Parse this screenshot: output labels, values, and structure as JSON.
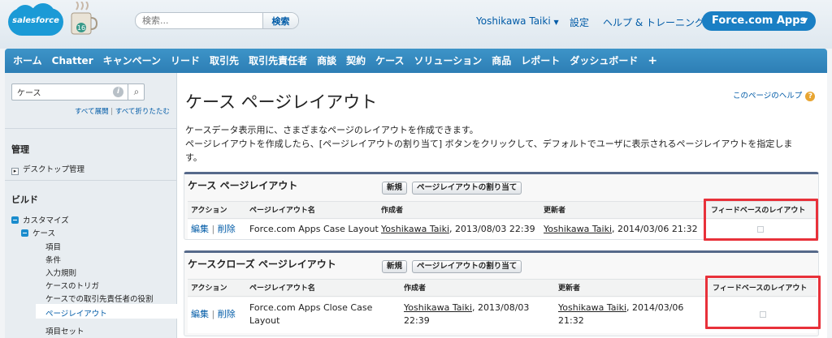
{
  "header": {
    "logo_text": "salesforce",
    "mug_badge": "16",
    "search_placeholder": "検索...",
    "search_button": "検索",
    "user_name": "Yoshikawa Taiki",
    "user_arrow": "▼",
    "setup": "設定",
    "help_training": "ヘルプ & トレーニング",
    "app_menu": "Force.com Apps",
    "app_arrow": "▼"
  },
  "tabs": [
    "ホーム",
    "Chatter",
    "キャンペーン",
    "リード",
    "取引先",
    "取引先責任者",
    "商談",
    "契約",
    "ケース",
    "ソリューション",
    "商品",
    "レポート",
    "ダッシュボード",
    "+"
  ],
  "sidebar": {
    "search_value": "ケース",
    "info_glyph": "i",
    "search_glyph": "⌕",
    "expand_all": "すべて展開",
    "separator": "|",
    "collapse_all": "すべて折りたたむ",
    "admin_heading": "管理",
    "desktop_admin": "デスクトップ管理",
    "build_heading": "ビルド",
    "customize": "カスタマイズ",
    "case": "ケース",
    "items": [
      "項目",
      "条件",
      "入力規則",
      "ケースのトリガ",
      "ケースでの取引先責任者の役割",
      "ページレイアウト",
      "項目セット"
    ]
  },
  "main": {
    "title": "ケース ページレイアウト",
    "help_link": "このページのヘルプ",
    "help_glyph": "?",
    "desc1": "ケースデータ表示用に、さまざまなページのレイアウトを作成できます。",
    "desc2": "ページレイアウトを作成したら、[ページレイアウトの割り当て] ボタンをクリックして、デフォルトでユーザに表示されるページレイアウトを指定しま",
    "desc3": "す。",
    "columns": {
      "action": "アクション",
      "layout_name": "ページレイアウト名",
      "created_by": "作成者",
      "modified_by": "更新者",
      "feed_based": "フィードベースのレイアウト"
    },
    "edit": "編集",
    "delete": "削除",
    "pipe": "|",
    "new_button": "新規",
    "assign_button": "ページレイアウトの割り当て",
    "panel1": {
      "title": "ケース ページレイアウト",
      "row": {
        "name": "Force.com Apps Case Layout",
        "created_user": "Yoshikawa Taiki",
        "created_date": ", 2013/08/03 22:39",
        "modified_user": "Yoshikawa Taiki",
        "modified_date": ", 2014/03/06 21:32",
        "feed_based": false
      }
    },
    "panel2": {
      "title": "ケースクローズ ページレイアウト",
      "row": {
        "name_line1": "Force.com Apps Close Case",
        "name_line2": "Layout",
        "created_user": "Yoshikawa Taiki",
        "created_date1": ", 2013/08/03",
        "created_date2": "22:39",
        "modified_user": "Yoshikawa Taiki",
        "modified_date1": ", 2014/03/06",
        "modified_date2": "21:32",
        "feed_based": false
      }
    }
  },
  "colors": {
    "accent": "#1a7fc4",
    "tab_bar": "#2d7eb5",
    "link": "#015ba7",
    "highlight": "#e8313a"
  }
}
